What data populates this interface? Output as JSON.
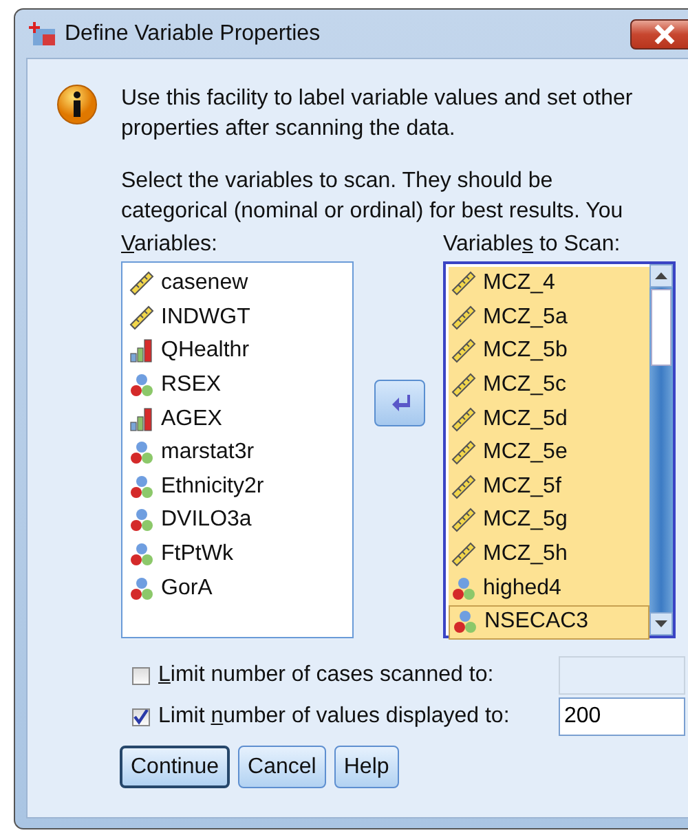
{
  "window": {
    "title": "Define Variable Properties"
  },
  "intro": "Use this facility to label variable values and set other properties after scanning the data.",
  "instructions": "Select the variables to scan. They should be categorical (nominal or ordinal) for best results. You",
  "source_list": {
    "label": {
      "key": "V",
      "post": "ariables:"
    },
    "items": [
      {
        "name": "casenew",
        "kind": "scale",
        "selected": false
      },
      {
        "name": "INDWGT",
        "kind": "scale",
        "selected": false
      },
      {
        "name": "QHealthr",
        "kind": "ordinal",
        "selected": false
      },
      {
        "name": "RSEX",
        "kind": "nominal",
        "selected": false
      },
      {
        "name": "AGEX",
        "kind": "ordinal",
        "selected": false
      },
      {
        "name": "marstat3r",
        "kind": "nominal",
        "selected": false
      },
      {
        "name": "Ethnicity2r",
        "kind": "nominal",
        "selected": false
      },
      {
        "name": "DVILO3a",
        "kind": "nominal",
        "selected": false
      },
      {
        "name": "FtPtWk",
        "kind": "nominal",
        "selected": false
      },
      {
        "name": "GorA",
        "kind": "nominal",
        "selected": false
      }
    ]
  },
  "target_list": {
    "label": {
      "pre": "Variable",
      "key": "s",
      "post": " to Scan:"
    },
    "items": [
      {
        "name": "MCZ_4",
        "kind": "scale",
        "selected": true
      },
      {
        "name": "MCZ_5a",
        "kind": "scale",
        "selected": true
      },
      {
        "name": "MCZ_5b",
        "kind": "scale",
        "selected": true
      },
      {
        "name": "MCZ_5c",
        "kind": "scale",
        "selected": true
      },
      {
        "name": "MCZ_5d",
        "kind": "scale",
        "selected": true
      },
      {
        "name": "MCZ_5e",
        "kind": "scale",
        "selected": true
      },
      {
        "name": "MCZ_5f",
        "kind": "scale",
        "selected": true
      },
      {
        "name": "MCZ_5g",
        "kind": "scale",
        "selected": true
      },
      {
        "name": "MCZ_5h",
        "kind": "scale",
        "selected": true
      },
      {
        "name": "highed4",
        "kind": "nominal",
        "selected": true
      },
      {
        "name": "NSECAC3",
        "kind": "nominal",
        "selected": true
      }
    ]
  },
  "options": [
    {
      "label": {
        "key": "L",
        "post": "imit number of cases scanned to:"
      },
      "checked": false,
      "disabled": true
    },
    {
      "label": {
        "pre": "Limit ",
        "key": "n",
        "post": "umber of values displayed to:"
      },
      "checked": true,
      "value": "200",
      "disabled": false
    }
  ],
  "buttons": [
    {
      "label": "Continue",
      "default": true
    },
    {
      "label": "Cancel",
      "default": false
    },
    {
      "label": "Help",
      "default": false
    }
  ]
}
